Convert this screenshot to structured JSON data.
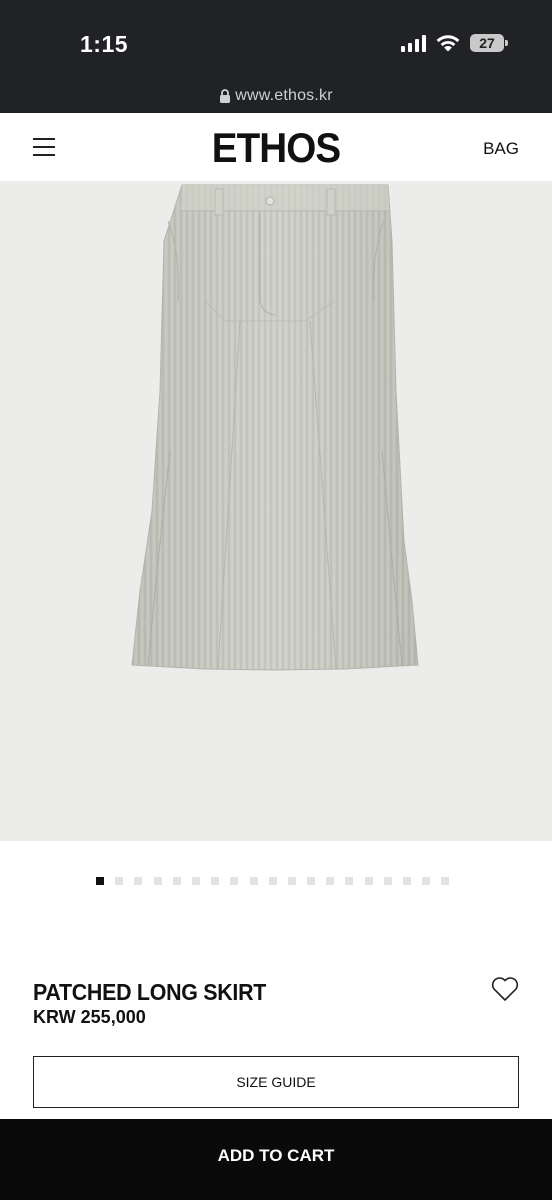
{
  "status_bar": {
    "time": "1:15",
    "battery": "27"
  },
  "browser": {
    "url": "www.ethos.kr"
  },
  "header": {
    "logo": "ETHOS",
    "bag_label": "BAG"
  },
  "carousel": {
    "total_slides": 19,
    "active_index": 0
  },
  "product": {
    "name": "PATCHED LONG SKIRT",
    "price": "KRW 255,000",
    "image_alt": "skirt"
  },
  "buttons": {
    "size_guide": "SIZE GUIDE",
    "add_to_cart": "ADD TO CART"
  },
  "icons": {
    "menu": "hamburger-menu-icon",
    "wishlist": "heart-icon",
    "lock": "lock-icon"
  },
  "colors": {
    "chrome_bg": "#202226",
    "image_bg": "#ececeb",
    "cta_bg": "#0a0a0a",
    "skirt": "#c9cac1"
  }
}
